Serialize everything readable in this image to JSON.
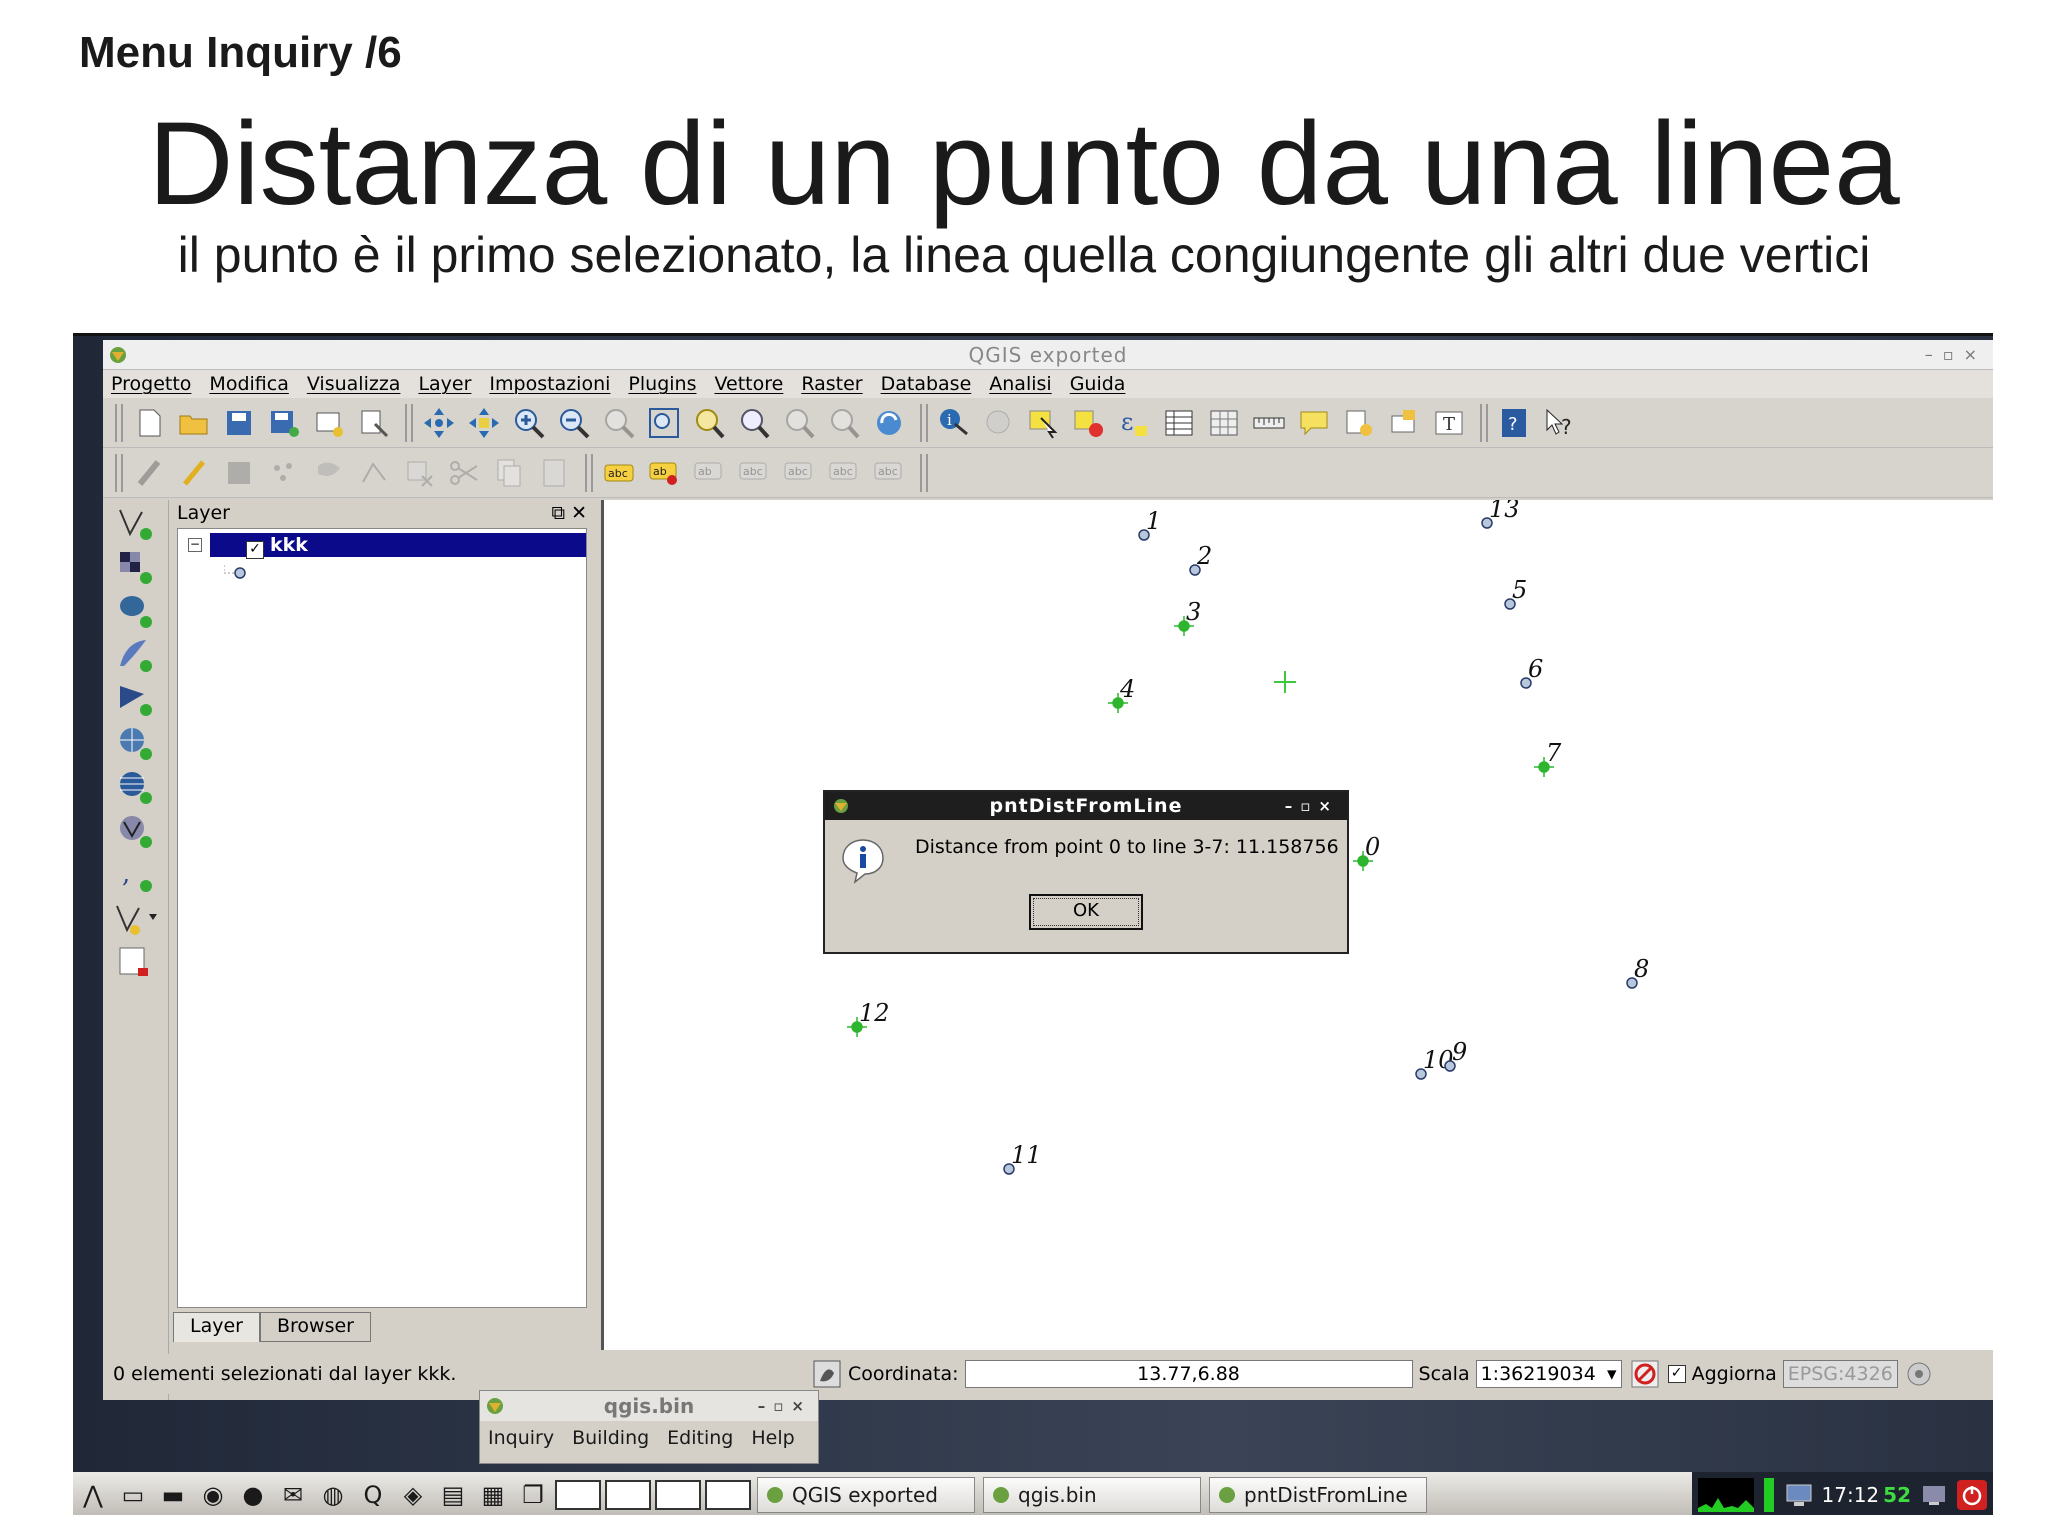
{
  "slide": {
    "kicker": "Menu Inquiry /6",
    "title": "Distanza di un punto da una linea",
    "subtitle": "il punto è il primo selezionato, la linea quella congiungente gli altri due vertici"
  },
  "qgis": {
    "window_title": "QGIS exported",
    "menu": [
      "Progetto",
      "Modifica",
      "Visualizza",
      "Layer",
      "Impostazioni",
      "Plugins",
      "Vettore",
      "Raster",
      "Database",
      "Analisi",
      "Guida"
    ],
    "layer_panel": {
      "title": "Layer",
      "layer_name": "kkk",
      "tabs": [
        "Layer",
        "Browser"
      ]
    },
    "status": {
      "selection_text": "0 elementi selezionati dal layer kkk.",
      "coord_label": "Coordinata:",
      "coord_value": "13.77,6.88",
      "scale_label": "Scala",
      "scale_value": "1:36219034",
      "render_label": "Aggiorna",
      "crs": "EPSG:4326"
    }
  },
  "map_points": [
    {
      "label": "1",
      "selected": false
    },
    {
      "label": "2",
      "selected": false
    },
    {
      "label": "3",
      "selected": true
    },
    {
      "label": "4",
      "selected": true
    },
    {
      "label": "13",
      "selected": false
    },
    {
      "label": "5",
      "selected": false
    },
    {
      "label": "6",
      "selected": false
    },
    {
      "label": "7",
      "selected": true
    },
    {
      "label": "0",
      "selected": true
    },
    {
      "label": "12",
      "selected": true
    },
    {
      "label": "8",
      "selected": false
    },
    {
      "label": "10",
      "selected": false
    },
    {
      "label": "9",
      "selected": false
    },
    {
      "label": "11",
      "selected": false
    },
    {
      "label": "",
      "selected": false
    }
  ],
  "dialog": {
    "title": "pntDistFromLine",
    "message": "Distance from point 0 to line 3-7: 11.158756",
    "ok_label": "OK"
  },
  "qgisbin": {
    "title": "qgis.bin",
    "menu": [
      "Inquiry",
      "Building",
      "Editing",
      "Help"
    ]
  },
  "taskbar": {
    "tasks": [
      "QGIS exported",
      "qgis.bin",
      "pntDistFromLine"
    ],
    "clock": "17:12",
    "clock_seconds": "52"
  },
  "colors": {
    "selection_highlight": "#0a0a8a",
    "selected_point": "#2fb52f",
    "point_fill": "#b8c8dc",
    "dialog_titlebar": "#1e1e1e"
  }
}
